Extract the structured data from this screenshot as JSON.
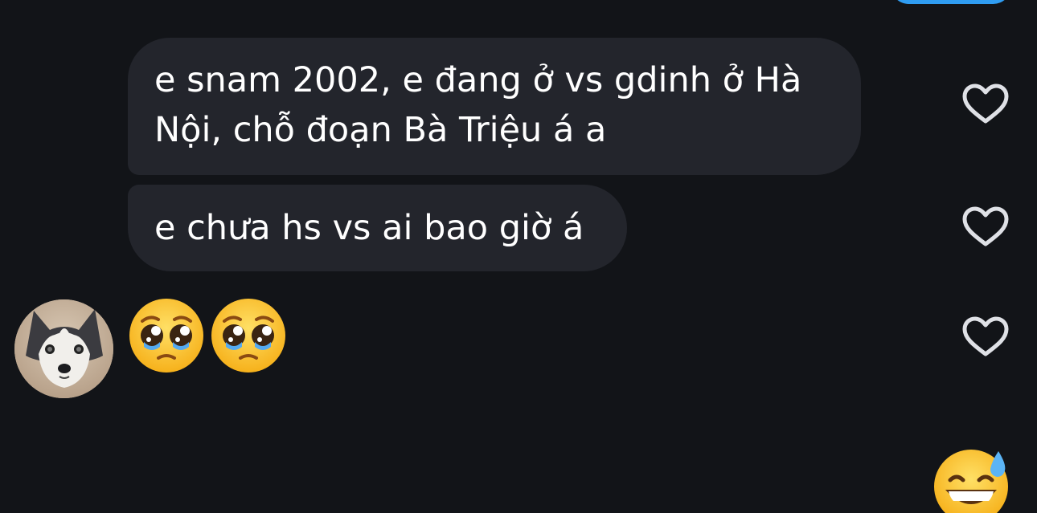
{
  "messages": [
    {
      "text_line1": "e snam 2002, e đang ở vs gdinh ở Hà",
      "text_line2": "Nội, chỗ đoạn Bà Triệu á a"
    },
    {
      "text": "e chưa hs vs ai bao giờ á"
    }
  ],
  "reaction_emojis": [
    "pleading-face",
    "pleading-face"
  ],
  "bottom_emoji": "grinning-face-with-sweat",
  "avatar": "husky-dog",
  "colors": {
    "background": "#121418",
    "bubble": "#23252c",
    "text": "#ffffff",
    "accent": "#2f9df2",
    "heart_outline": "#dfe1e6"
  },
  "icons": [
    "heart-outline-icon"
  ]
}
